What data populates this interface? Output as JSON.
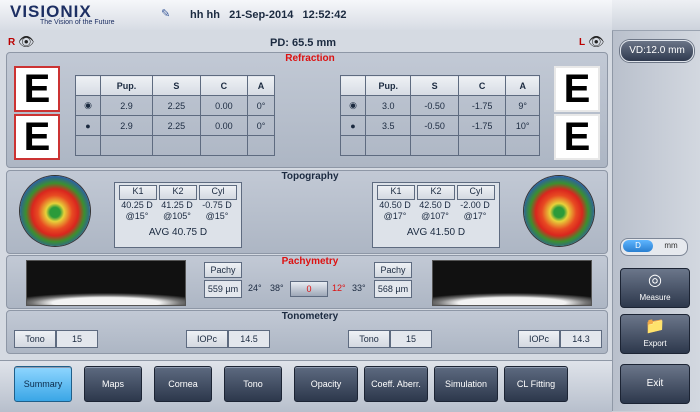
{
  "header": {
    "logo": "VISIONIX",
    "tagline": "The Vision of the Future",
    "patient": "hh hh",
    "date": "21-Sep-2014",
    "time": "12:52:42"
  },
  "vd_label": "VD:12.0 mm",
  "pd_label": "PD: 65.5 mm",
  "eyes": {
    "right": "R",
    "left": "L"
  },
  "refraction": {
    "title": "Refraction",
    "headers": [
      "Pup.",
      "S",
      "C",
      "A"
    ],
    "right_rows": [
      [
        "2.9",
        "2.25",
        "0.00",
        "0°"
      ],
      [
        "2.9",
        "2.25",
        "0.00",
        "0°"
      ]
    ],
    "left_rows": [
      [
        "3.0",
        "-0.50",
        "-1.75",
        "9°"
      ],
      [
        "3.5",
        "-0.50",
        "-1.75",
        "10°"
      ]
    ]
  },
  "topography": {
    "title": "Topography",
    "headers": [
      "K1",
      "K2",
      "Cyl"
    ],
    "right": {
      "k1": "40.25 D",
      "k1a": "@15°",
      "k2": "41.25 D",
      "k2a": "@105°",
      "cyl": "-0.75 D",
      "cyla": "@15°",
      "avg": "AVG 40.75 D"
    },
    "left": {
      "k1": "40.50 D",
      "k1a": "@17°",
      "k2": "42.50 D",
      "k2a": "@107°",
      "cyl": "-2.00 D",
      "cyla": "@17°",
      "avg": "AVG 41.50 D"
    }
  },
  "pachymetry": {
    "title": "Pachymetry",
    "label": "Pachy",
    "right_value": "559 µm",
    "left_value": "568 µm",
    "angles": [
      "24°",
      "38°",
      "0",
      "12°",
      "33°"
    ]
  },
  "tonometry": {
    "title": "Tonometery",
    "tono_label": "Tono",
    "iopc_label": "IOPc",
    "right_tono": "15",
    "right_iopc": "14.5",
    "left_tono": "15",
    "left_iopc": "14.3"
  },
  "nav": [
    "Summary",
    "Maps",
    "Cornea",
    "Tono",
    "Opacity",
    "Coeff. Aberr.",
    "Simulation",
    "CL Fitting"
  ],
  "side": {
    "toggle_d": "D",
    "toggle_mm": "mm",
    "measure": "Measure",
    "export": "Export",
    "exit": "Exit"
  },
  "colors": {
    "accent_red": "#d11111",
    "active_nav": "#3aa6e6"
  }
}
